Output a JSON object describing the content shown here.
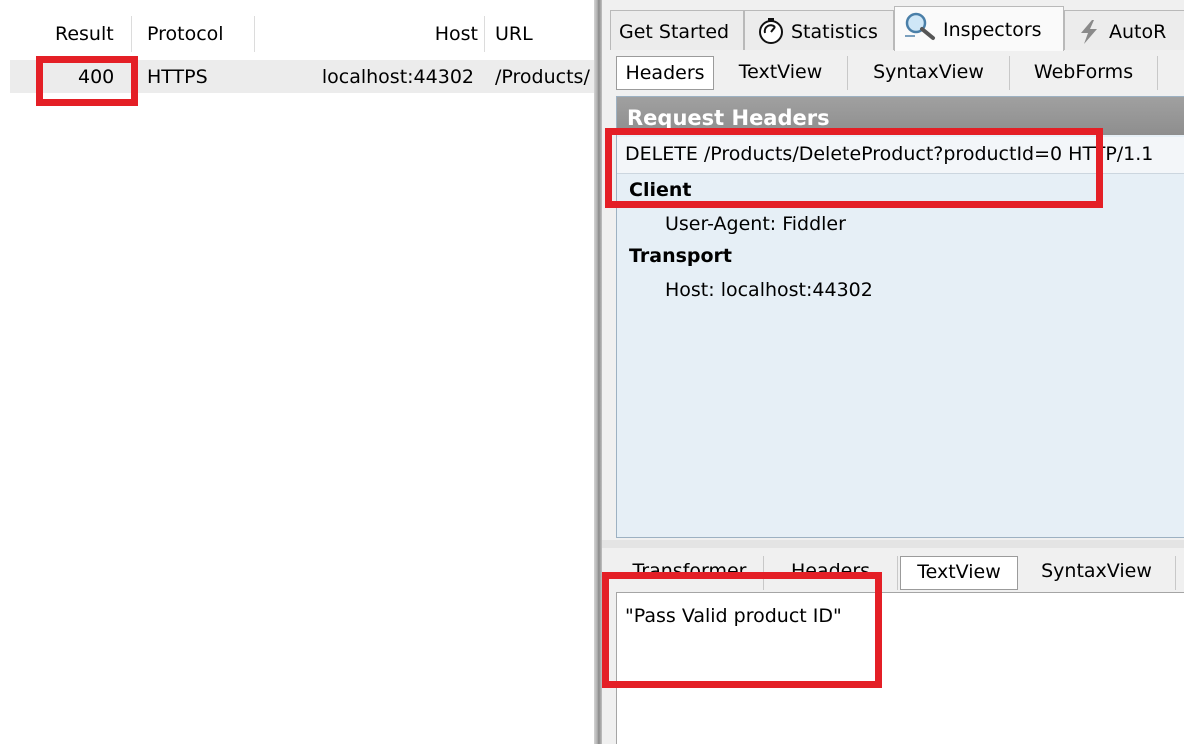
{
  "sessions": {
    "columns": [
      "Result",
      "Protocol",
      "Host",
      "URL"
    ],
    "rows": [
      {
        "result": "400",
        "protocol": "HTTPS",
        "host": "localhost:44302",
        "url": "/Products/"
      }
    ]
  },
  "inspector": {
    "main_tabs": [
      {
        "label": "Get Started",
        "icon": ""
      },
      {
        "label": "Statistics",
        "icon": "stopwatch-icon"
      },
      {
        "label": "Inspectors",
        "icon": "magnifier-icon"
      },
      {
        "label": "AutoR",
        "icon": "lightning-icon"
      }
    ],
    "request_tabs": [
      "Headers",
      "TextView",
      "SyntaxView",
      "WebForms"
    ],
    "request_headers": {
      "title": "Request Headers",
      "request_line": "DELETE /Products/DeleteProduct?productId=0 HTTP/1.1",
      "groups": [
        {
          "name": "Client",
          "entries": [
            "User-Agent: Fiddler"
          ]
        },
        {
          "name": "Transport",
          "entries": [
            "Host: localhost:44302"
          ]
        }
      ]
    },
    "response_tabs": [
      "Transformer",
      "Headers",
      "TextView",
      "SyntaxView"
    ],
    "response_body": "\"Pass Valid product ID\""
  },
  "colors": {
    "highlight": "#e41f26",
    "request_panel_bg": "#e6eff6",
    "title_bar": "#979797"
  }
}
